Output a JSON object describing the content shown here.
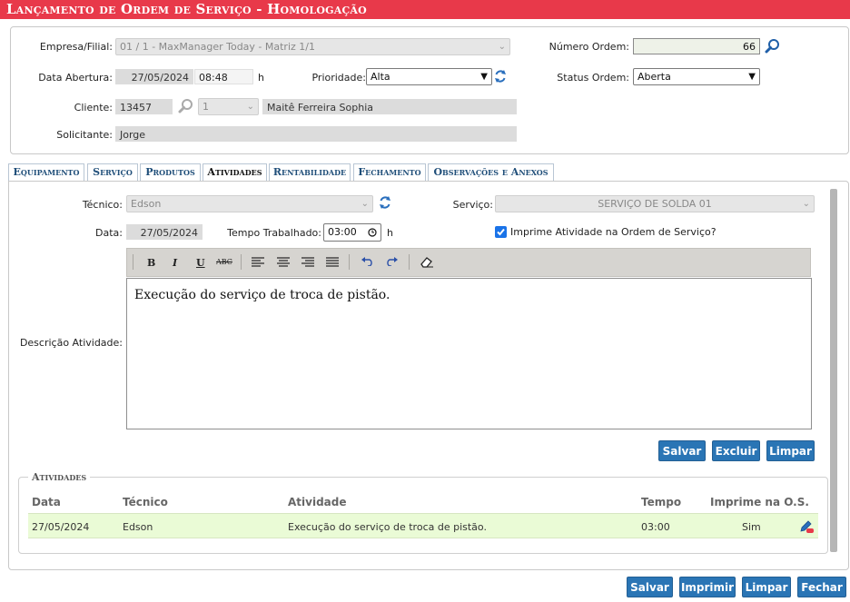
{
  "title": "Lançamento de Ordem de Serviço  - Homologação",
  "header": {
    "empresa_label": "Empresa/Filial:",
    "empresa_value": "01 / 1 - MaxManager Today - Matriz 1/1",
    "numero_label": "Número Ordem:",
    "numero_value": "66",
    "data_abertura_label": "Data Abertura:",
    "data_abertura_date": "27/05/2024",
    "data_abertura_time": "08:48",
    "data_abertura_unit": "h",
    "prioridade_label": "Prioridade:",
    "prioridade_value": "Alta",
    "status_label": "Status Ordem:",
    "status_value": "Aberta",
    "cliente_label": "Cliente:",
    "cliente_code": "13457",
    "cliente_sub": "1",
    "cliente_name": "Maitê Ferreira Sophia",
    "solicitante_label": "Solicitante:",
    "solicitante_value": "Jorge"
  },
  "tabs": [
    {
      "label": "Equipamento"
    },
    {
      "label": "Serviço"
    },
    {
      "label": "Produtos"
    },
    {
      "label": "Atividades"
    },
    {
      "label": "Rentabilidade"
    },
    {
      "label": "Fechamento"
    },
    {
      "label": "Observações e Anexos"
    }
  ],
  "activity": {
    "tecnico_label": "Técnico:",
    "tecnico_value": "Edson",
    "servico_label": "Serviço:",
    "servico_value": "SERVIÇO DE SOLDA 01",
    "data_label": "Data:",
    "data_value": "27/05/2024",
    "tempo_label": "Tempo Trabalhado:",
    "tempo_value": "03:00",
    "tempo_unit": "h",
    "imprime_label": "Imprime Atividade na Ordem de Serviço?",
    "descricao_label": "Descrição Atividade:",
    "descricao_text": "Execução do serviço de troca de pistão.",
    "toolbar": {
      "bold": "B",
      "italic": "I",
      "underline": "U",
      "strike": "ABC"
    },
    "buttons": {
      "salvar": "Salvar",
      "excluir": "Excluir",
      "limpar": "Limpar"
    }
  },
  "grid": {
    "legend": "Atividades",
    "columns": [
      "Data",
      "Técnico",
      "Atividade",
      "Tempo",
      "Imprime na O.S."
    ],
    "rows": [
      {
        "data": "27/05/2024",
        "tecnico": "Edson",
        "atividade": "Execução do serviço de troca de pistão.",
        "tempo": "03:00",
        "imprime": "Sim"
      }
    ]
  },
  "footer": {
    "salvar": "Salvar",
    "imprimir": "Imprimir",
    "limpar": "Limpar",
    "fechar": "Fechar"
  },
  "colors": {
    "title_bar": "#e8394a",
    "button": "#2a75b5",
    "row_highlight": "#eafbd6"
  }
}
